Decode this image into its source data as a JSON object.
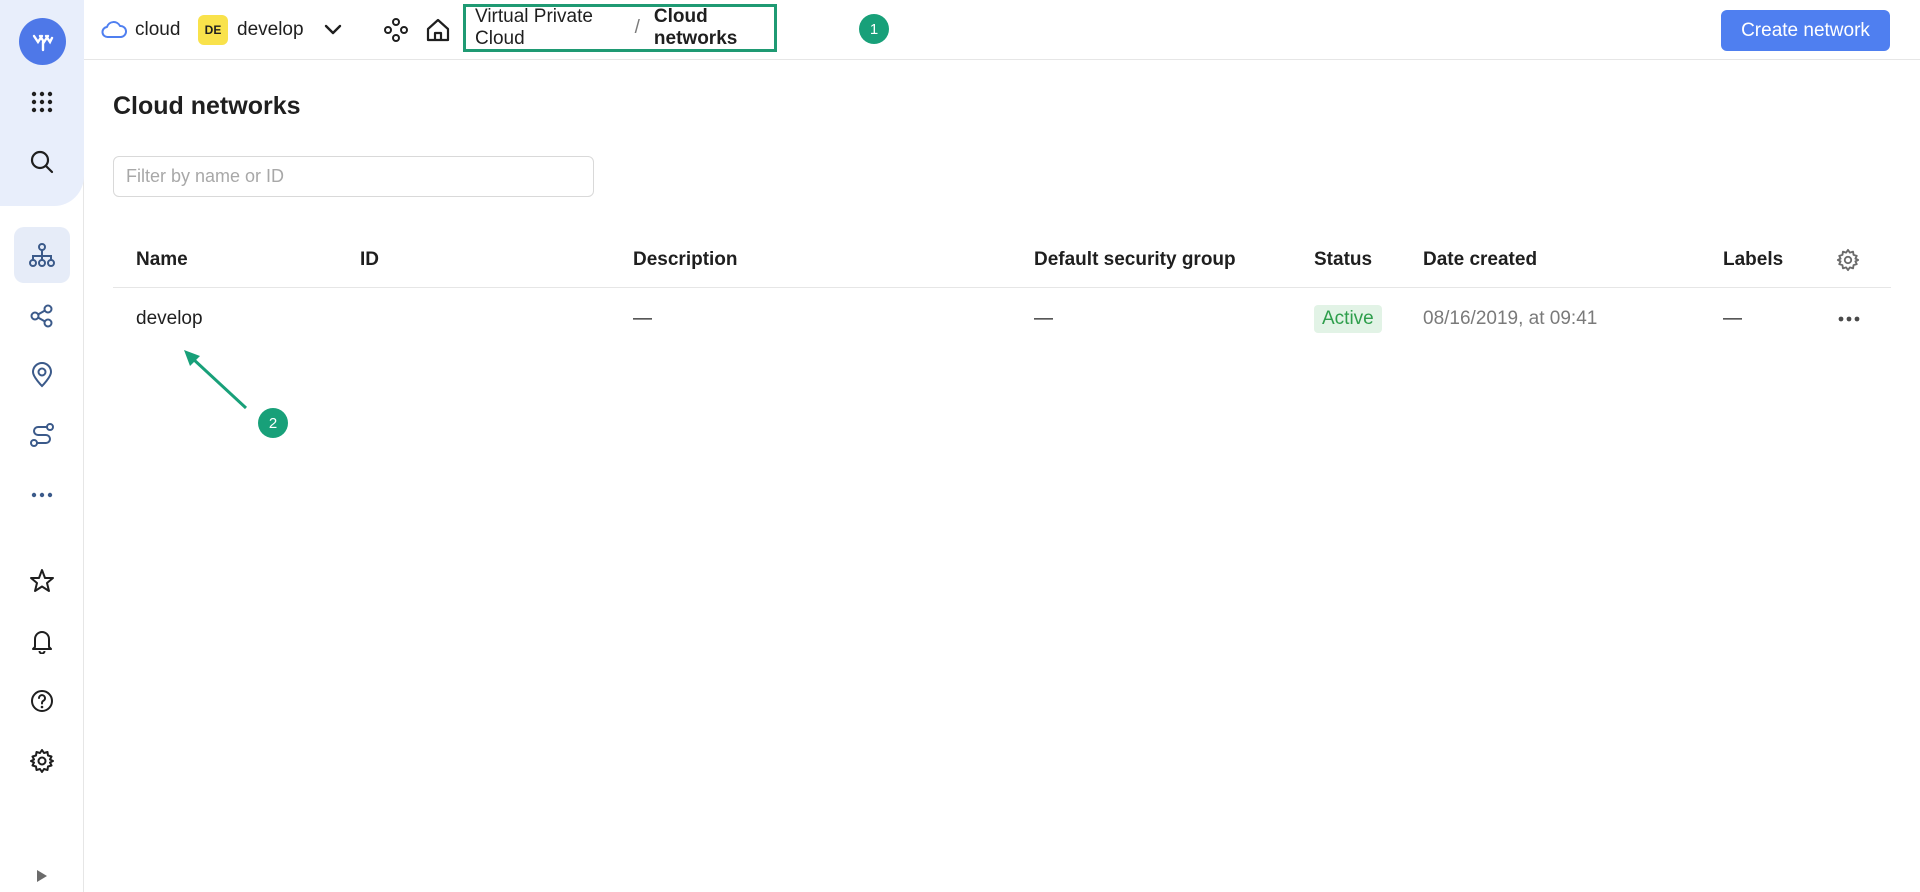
{
  "colors": {
    "accent": "#4f7ff0",
    "annotation": "#18a079",
    "status_active_bg": "#e2f3e6",
    "status_active_text": "#2e9e4c",
    "folder_badge": "#f9e24b"
  },
  "sidebar": {
    "logo_icon": "ycloud-logo-icon",
    "items": [
      {
        "icon": "apps-grid-icon"
      },
      {
        "icon": "search-icon"
      },
      {
        "icon": "network-icon",
        "active": true
      },
      {
        "icon": "share-nodes-icon"
      },
      {
        "icon": "location-pin-icon"
      },
      {
        "icon": "route-icon"
      },
      {
        "icon": "more-horizontal-icon"
      },
      {
        "icon": "star-icon"
      },
      {
        "icon": "bell-icon"
      },
      {
        "icon": "help-icon"
      },
      {
        "icon": "gear-icon"
      }
    ],
    "collapse_icon": "expand-triangle-icon"
  },
  "header": {
    "cloud_label": "cloud",
    "folder_badge": "DE",
    "folder_label": "develop",
    "breadcrumb": {
      "service": "Virtual Private Cloud",
      "separator": "/",
      "current": "Cloud networks"
    },
    "step1": "1",
    "create_button": "Create network"
  },
  "main": {
    "title": "Cloud networks",
    "filter_placeholder": "Filter by name or ID",
    "table": {
      "columns": [
        "Name",
        "ID",
        "Description",
        "Default security group",
        "Status",
        "Date created",
        "Labels"
      ],
      "rows": [
        {
          "name": "develop",
          "id": "",
          "description": "—",
          "security_group": "—",
          "status": "Active",
          "date_created": "08/16/2019, at 09:41",
          "labels": "—"
        }
      ]
    },
    "step2": "2"
  }
}
